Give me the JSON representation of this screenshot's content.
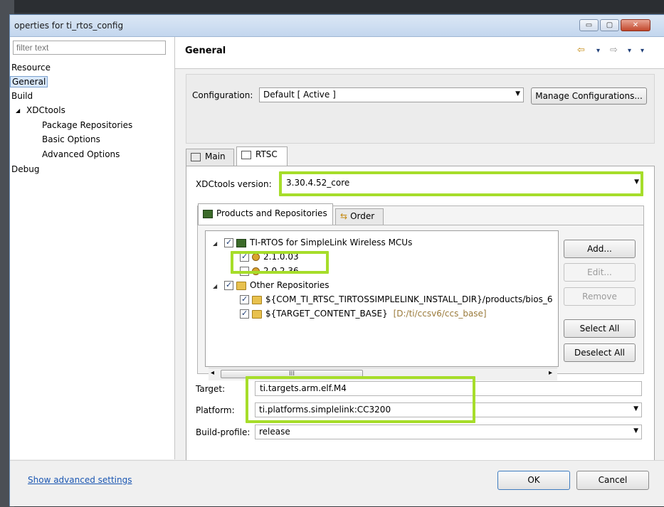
{
  "window": {
    "title": "operties for ti_rtos_config",
    "min_glyph": "▭",
    "max_glyph": "▢",
    "close_glyph": "✕"
  },
  "left": {
    "filter_placeholder": "filter text",
    "items": [
      {
        "label": "Resource"
      },
      {
        "label": "General"
      },
      {
        "label": "Build"
      },
      {
        "label": "XDCtools"
      },
      {
        "label": "Package Repositories"
      },
      {
        "label": "Basic Options"
      },
      {
        "label": "Advanced Options"
      },
      {
        "label": "Debug"
      }
    ],
    "xdc_expander": "◢"
  },
  "header": {
    "title": "General",
    "back_arrow": "⇦",
    "fwd_arrow": "⇨",
    "dropdown": "▾"
  },
  "config": {
    "label": "Configuration:",
    "value": "Default  [ Active ]",
    "manage_button": "Manage Configurations..."
  },
  "tabs": [
    {
      "label": "Main"
    },
    {
      "label": "RTSC"
    }
  ],
  "rtsc": {
    "xdc_label": "XDCtools version:",
    "xdc_value": "3.30.4.52_core",
    "subtabs": [
      {
        "label": "Products and Repositories"
      },
      {
        "label": "Order"
      }
    ],
    "tree": [
      {
        "text": "TI-RTOS for SimpleLink Wireless MCUs",
        "checked": true
      },
      {
        "text": "2.1.0.03",
        "checked": true
      },
      {
        "text": "2.0.2.36",
        "checked": false
      },
      {
        "text": "Other Repositories",
        "checked": true
      },
      {
        "text": "${COM_TI_RTSC_TIRTOSSIMPLELINK_INSTALL_DIR}/products/bios_6",
        "checked": true
      },
      {
        "text": "${TARGET_CONTENT_BASE}",
        "suffix": "[D:/ti/ccsv6/ccs_base]",
        "checked": true
      }
    ],
    "scroll_grip": "III",
    "scroll_left": "◂",
    "scroll_right": "▸",
    "buttons": {
      "add": "Add...",
      "edit": "Edit...",
      "remove": "Remove",
      "select_all": "Select All",
      "deselect_all": "Deselect All"
    },
    "target_label": "Target:",
    "target_value": "ti.targets.arm.elf.M4",
    "platform_label": "Platform:",
    "platform_value": "ti.platforms.simplelink:CC3200",
    "build_profile_label": "Build-profile:",
    "build_profile_value": "release"
  },
  "footer": {
    "advanced_link": "Show advanced settings",
    "ok": "OK",
    "cancel": "Cancel"
  },
  "colors": {
    "highlight": "#a6dd2a",
    "link": "#1a56b2"
  }
}
